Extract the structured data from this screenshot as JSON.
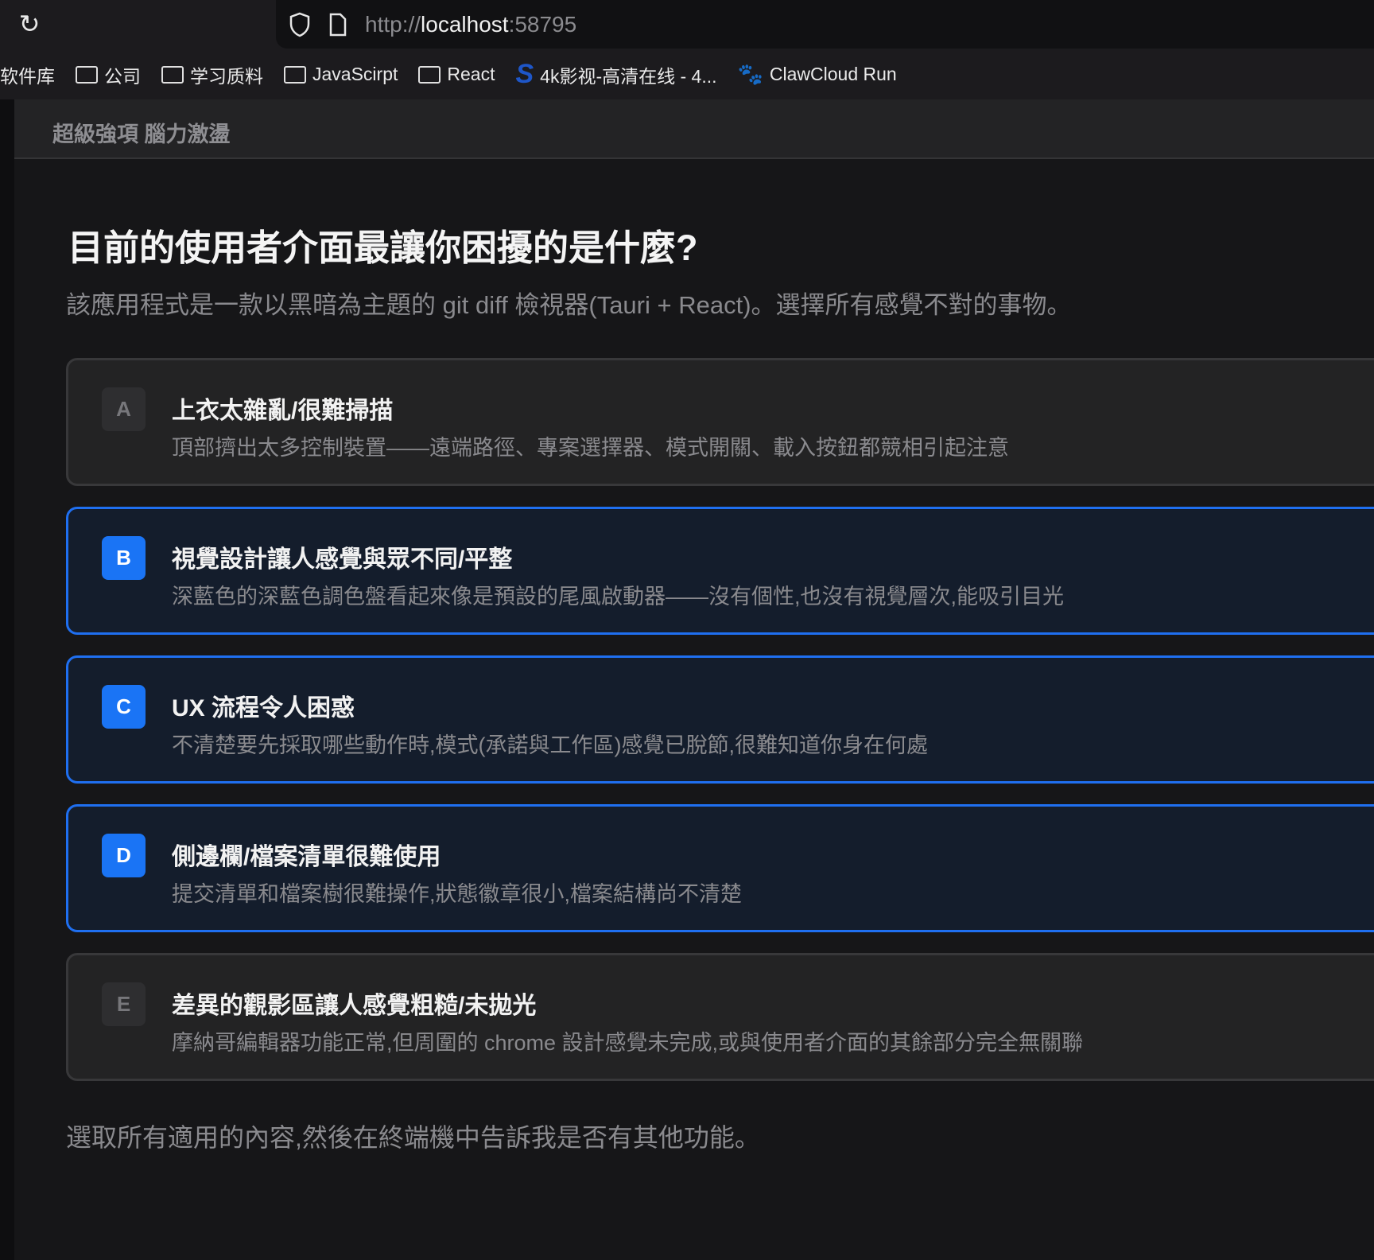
{
  "browser": {
    "url_scheme": "http://",
    "url_host": "localhost",
    "url_port": ":58795",
    "bookmarks": [
      "软件库",
      "公司",
      "学习质料",
      "JavaScirpt",
      "React",
      "4k影视-高清在线 - 4...",
      "ClawCloud Run"
    ]
  },
  "header": {
    "title": "超級強項 腦力激盪"
  },
  "main": {
    "question": "目前的使用者介面最讓你困擾的是什麼?",
    "subtitle": "該應用程式是一款以黑暗為主題的 git diff 檢視器(Tauri + React)。選擇所有感覺不對的事物。",
    "options": [
      {
        "letter": "A",
        "title": "上衣太雜亂/很難掃描",
        "desc": "頂部擠出太多控制裝置——遠端路徑、專案選擇器、模式開關、載入按鈕都競相引起注意",
        "selected": false
      },
      {
        "letter": "B",
        "title": "視覺設計讓人感覺與眾不同/平整",
        "desc": "深藍色的深藍色調色盤看起來像是預設的尾風啟動器——沒有個性,也沒有視覺層次,能吸引目光",
        "selected": true
      },
      {
        "letter": "C",
        "title": "UX 流程令人困惑",
        "desc": "不清楚要先採取哪些動作時,模式(承諾與工作區)感覺已脫節,很難知道你身在何處",
        "selected": true
      },
      {
        "letter": "D",
        "title": "側邊欄/檔案清單很難使用",
        "desc": "提交清單和檔案樹很難操作,狀態徽章很小,檔案結構尚不清楚",
        "selected": true
      },
      {
        "letter": "E",
        "title": "差異的觀影區讓人感覺粗糙/未拋光",
        "desc": "摩納哥編輯器功能正常,但周圍的 chrome 設計感覺未完成,或與使用者介面的其餘部分完全無關聯",
        "selected": false
      }
    ],
    "footer": "選取所有適用的內容,然後在終端機中告訴我是否有其他功能。"
  },
  "colors": {
    "accent": "#1f6ff0",
    "selected_bg": "#141d2c",
    "card_bg": "#232324"
  }
}
